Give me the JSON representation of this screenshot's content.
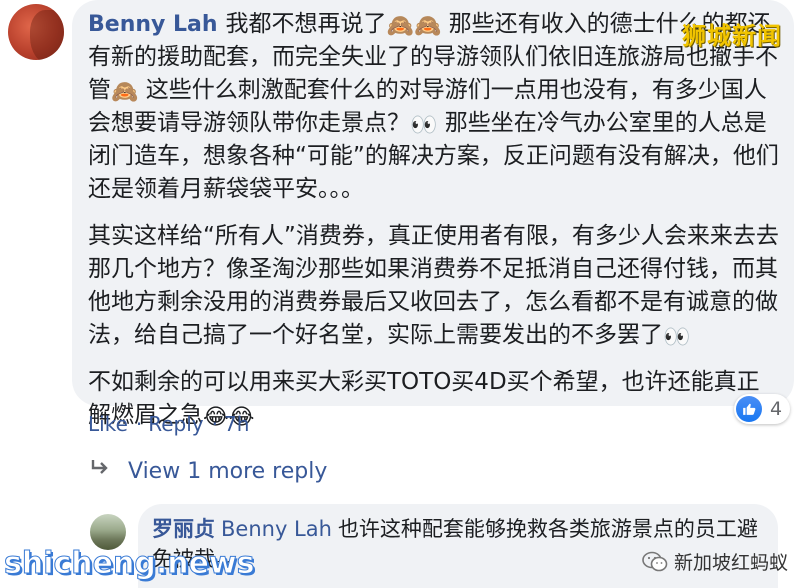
{
  "main_comment": {
    "author": "Benny Lah",
    "paragraphs": [
      [
        {
          "t": "我都不想再说了"
        },
        {
          "e": "🙈"
        },
        {
          "e": "🙈"
        },
        {
          "t": " 那些还有收入的德士什么的都还有新的援助配套，而完全失业了的导游领队们依旧连旅游局也撤手不管"
        },
        {
          "e": "🙈"
        },
        {
          "t": " 这些什么刺激配套什么的对导游们一点用也没有，有多少国人会想要请导游领队带你走景点？"
        },
        {
          "e": "👀"
        },
        {
          "t": " 那些坐在冷气办公室里的人总是闭门造车，想象各种“可能”的解决方案，反正问题有没有解决，他们还是领着月薪袋袋平安。。。"
        }
      ],
      [
        {
          "t": "其实这样给“所有人”消费券，真正使用者有限，有多少人会来来去去那几个地方？像圣淘沙那些如果消费券不足抵消自己还得付钱，而其他地方剩余没用的消费券最后又收回去了，怎么看都不是有诚意的做法，给自己搞了一个好名堂，实际上需要发出的不多罢了"
        },
        {
          "e": "👀"
        }
      ],
      [
        {
          "t": "不如剩余的可以用来买大彩买TOTO买4D买个希望，也许还能真正解燃眉之急"
        },
        {
          "e": "😂"
        },
        {
          "e": "😂"
        }
      ]
    ],
    "reaction_count": "4",
    "actions": {
      "like": "Like",
      "reply": "Reply",
      "time": "7h",
      "separator": "·"
    }
  },
  "view_more_label": "View 1 more reply",
  "reply": {
    "author": "罗丽贞",
    "mention": "Benny Lah",
    "text": "也许这种配套能够挽救各类旅游景点的员工避免被裁。。"
  },
  "watermarks": {
    "top_right": "狮城新闻",
    "bottom_left": "shicheng.news",
    "bottom_right": "新加坡红蚂蚁"
  },
  "colors": {
    "link": "#385898",
    "bubble": "#f0f2f5",
    "like_blue": "#1877f2"
  }
}
